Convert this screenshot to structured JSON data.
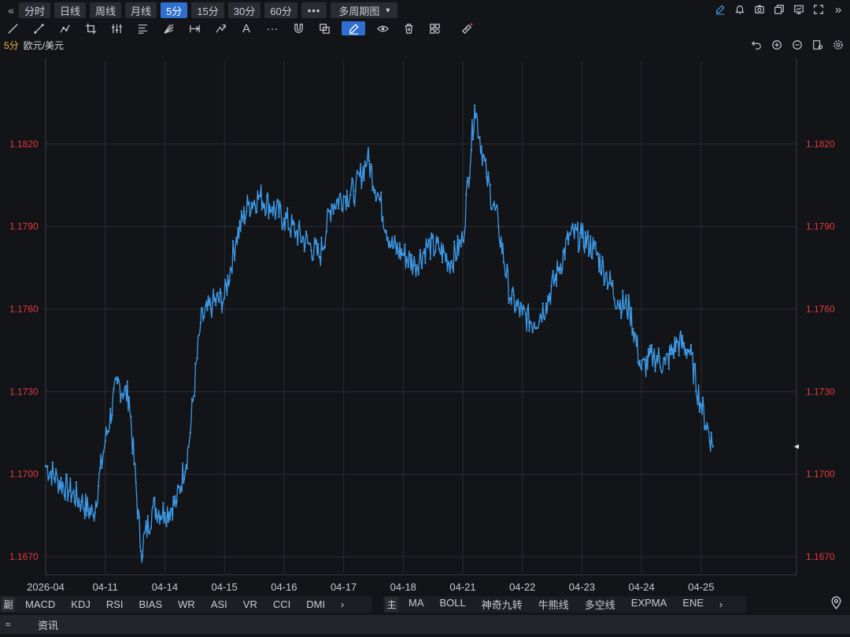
{
  "periods": {
    "collapse": "«",
    "expand": "»",
    "items": [
      "分时",
      "日线",
      "周线",
      "月线",
      "5分",
      "15分",
      "30分",
      "60分"
    ],
    "active_index": 4,
    "more": "•••",
    "multi": "多周期图"
  },
  "draw_tools": {
    "text_tool": "A",
    "more": "···"
  },
  "symbol": {
    "timeframe": "5分",
    "name": "欧元/美元"
  },
  "indicators": {
    "sub_tag": "副",
    "sub_items": [
      "MACD",
      "KDJ",
      "RSI",
      "BIAS",
      "WR",
      "ASI",
      "VR",
      "CCI",
      "DMI"
    ],
    "main_tag": "主",
    "main_items": [
      "MA",
      "BOLL",
      "神奇九转",
      "牛熊线",
      "多空线",
      "EXPMA",
      "ENE"
    ],
    "arrow": "›"
  },
  "footer": {
    "expand": "≈",
    "tab": "资讯"
  },
  "colors": {
    "line": "#3d9be9",
    "price_label": "#e23a3a",
    "grid": "#2a2d35",
    "axis_text": "#c8cbd2"
  },
  "chart_data": {
    "type": "line",
    "interval": "5分",
    "symbol": "欧元/美元",
    "ylim": [
      1.1664,
      1.185
    ],
    "y_ticks": [
      1.167,
      1.17,
      1.173,
      1.176,
      1.179,
      1.182
    ],
    "x_ticks": [
      "2026-04",
      "04-11",
      "04-14",
      "04-15",
      "04-16",
      "04-17",
      "04-18",
      "04-21",
      "04-22",
      "04-23",
      "04-24",
      "04-25"
    ],
    "grid": true,
    "series": [
      {
        "x": [
          0,
          0.2,
          0.4,
          0.6,
          0.8,
          1.0,
          1.2,
          1.4,
          1.6,
          1.8,
          2.0,
          2.2,
          2.4,
          2.6,
          2.8,
          3.0,
          3.2,
          3.4,
          3.6,
          3.8,
          4.0,
          4.2,
          4.4,
          4.6,
          4.8,
          5.0,
          5.2,
          5.4,
          5.6,
          5.8,
          6.0,
          6.2,
          6.4,
          6.6,
          6.8,
          7.0,
          7.2,
          7.4,
          7.6,
          7.8,
          8.0,
          8.2,
          8.4,
          8.6,
          8.8,
          9.0,
          9.2,
          9.4,
          9.6,
          9.8,
          10.0,
          10.2,
          10.4,
          10.6,
          10.8,
          11.0,
          11.2
        ],
        "values": [
          1.1703,
          1.1698,
          1.1694,
          1.169,
          1.1685,
          1.1712,
          1.1733,
          1.1728,
          1.1672,
          1.1688,
          1.1686,
          1.169,
          1.171,
          1.1755,
          1.1762,
          1.1764,
          1.1786,
          1.1798,
          1.1801,
          1.1797,
          1.1793,
          1.1788,
          1.1784,
          1.1779,
          1.1798,
          1.1801,
          1.1803,
          1.1815,
          1.18,
          1.1783,
          1.178,
          1.1776,
          1.1783,
          1.1782,
          1.1777,
          1.1785,
          1.1834,
          1.1808,
          1.179,
          1.1764,
          1.1758,
          1.1755,
          1.1762,
          1.1774,
          1.1787,
          1.1786,
          1.1782,
          1.1773,
          1.1763,
          1.176,
          1.1738,
          1.1743,
          1.174,
          1.1748,
          1.1745,
          1.1725,
          1.171
        ]
      }
    ]
  }
}
